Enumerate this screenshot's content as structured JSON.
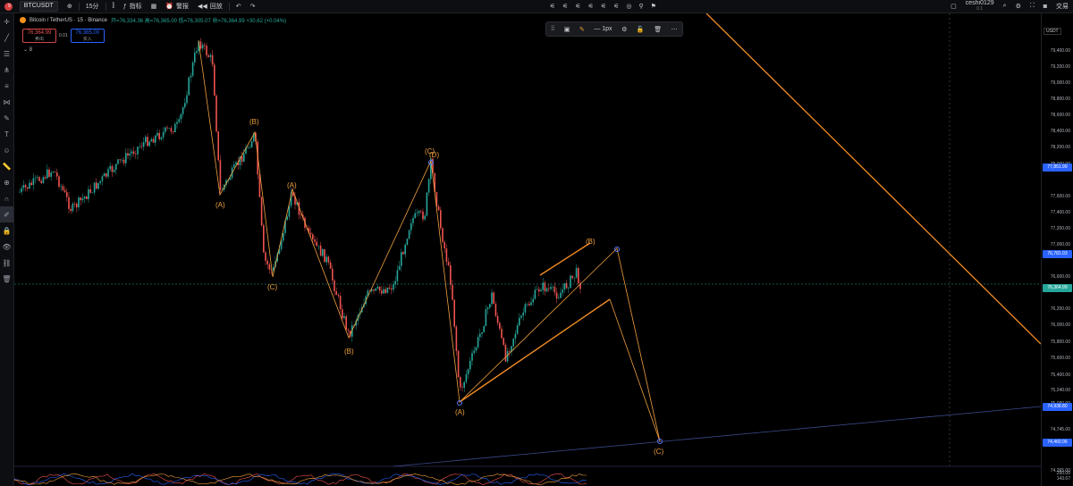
{
  "topbar": {
    "badge": "9",
    "symbol": "BTCUSDT",
    "interval": "15分",
    "indicators_label": "指标",
    "alert_label": "警报",
    "replay_label": "回放",
    "user": "ceshi0129",
    "user_sub": "0.1",
    "trade_label": "交易"
  },
  "legend": {
    "title": "Bitcoin / TetherUS · 15 · Binance",
    "ohlc": "开=76,334.36 高=76,365.00 低=76,305.07 收=76,364.99 +30.62 (+0.04%)"
  },
  "pricebox": {
    "sell_price": "76,364.99",
    "sell_label": "卖出",
    "spread": "0.01",
    "buy_price": "76,365.00",
    "buy_label": "买入"
  },
  "count": "8",
  "drawing_toolbar": {
    "width_label": "1px"
  },
  "axis": {
    "currency": "USDT",
    "ticks": [
      "79,400.00",
      "79,200.00",
      "79,000.00",
      "78,800.00",
      "78,600.00",
      "78,400.00",
      "78,200.00",
      "78,000.00",
      "77,600.00",
      "77,400.00",
      "77,200.00",
      "77,000.00",
      "76,600.00",
      "76,200.00",
      "76,000.00",
      "75,800.00",
      "75,600.00",
      "75,400.00",
      "75,240.00",
      "75,080.00",
      "74,745.00",
      "74,585.00",
      "74,265.00"
    ],
    "tags": [
      {
        "value": "77,851.99",
        "color": "#2962ff"
      },
      {
        "value": "76,781.03",
        "color": "#2962ff"
      },
      {
        "value": "76,364.99",
        "color": "#26a69a"
      },
      {
        "value": "74,938.80",
        "color": "#2962ff"
      },
      {
        "value": "74,460.06",
        "color": "#2962ff"
      }
    ],
    "bottom_values": [
      "250.00",
      "143.67"
    ]
  },
  "wave_labels": {
    "a1": "(A)",
    "b1": "(B)",
    "c1": "(C)",
    "a2": "(A)",
    "b2": "(B)",
    "c2": "(C)",
    "a3": "(A)",
    "b3": "(B)",
    "c3": "(C)",
    "d": "(D)"
  },
  "colors": {
    "up": "#26a69a",
    "down": "#ef5350",
    "wave": "#f0a040",
    "trend": "#3a4a8a"
  }
}
